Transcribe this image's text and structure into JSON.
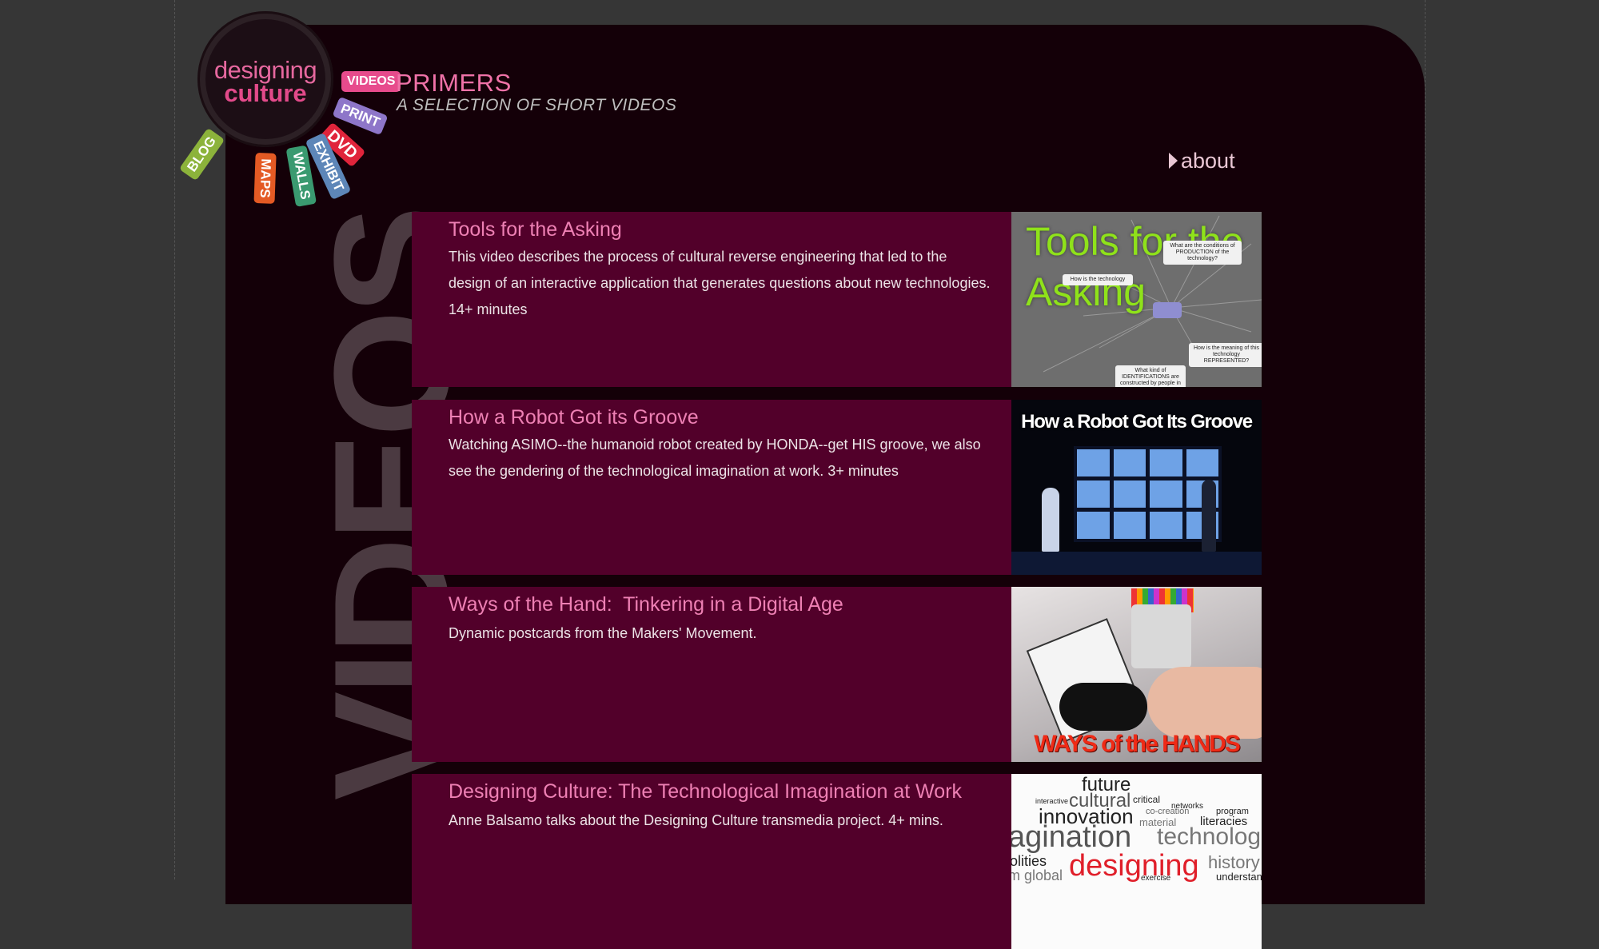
{
  "logo": {
    "line1": "designing",
    "line2": "culture"
  },
  "nav_tags": {
    "videos": "VIDEOS",
    "print": "PRINT",
    "dvd": "DVD",
    "exhibit": "EXHIBIT",
    "walls": "WALLS",
    "maps": "MAPS",
    "blog": "BLOG"
  },
  "header": {
    "title": "PRIMERS",
    "subtitle": "A SELECTION OF SHORT VIDEOS",
    "about_label": "about"
  },
  "section_word": "VIDEOS",
  "videos": [
    {
      "title": "Tools for the Asking",
      "description": "This video describes the process of cultural reverse engineering that led to the design of an interactive application that generates questions about new technologies. 14+ minutes",
      "thumb_text": "Tools for the Asking",
      "thumb_notes": [
        "What are the conditions of PRODUCTION of the technology?",
        "How is the technology",
        "How is the meaning of this technology REPRESENTED?",
        "What kind of IDENTIFICATIONS are constructed by people in"
      ]
    },
    {
      "title": "How a Robot Got its Groove",
      "description": "Watching ASIMO--the humanoid robot created by HONDA--get HIS groove, we also see the gendering of the technological imagination at work. 3+ minutes",
      "thumb_text": "How a Robot Got Its Groove"
    },
    {
      "title": "Ways of the Hand:  Tinkering in a Digital Age",
      "description": "Dynamic postcards from the Makers' Movement.",
      "thumb_text": "WAYS of the HANDS"
    },
    {
      "title": "Designing Culture: The Technological Imagination at Work",
      "description": "Anne Balsamo talks about the Designing Culture transmedia project. 4+ mins.",
      "thumb_words": [
        "future",
        "cultural",
        "critical",
        "interactive",
        "networks",
        "innovation",
        "co-creation",
        "program",
        "material",
        "literacies",
        "agination",
        "technologies",
        "olities",
        "designing",
        "history",
        "m global",
        "exercise",
        "understan"
      ]
    }
  ],
  "colors": {
    "background": "#363636",
    "panel": "#140008",
    "row": "#52002a",
    "accent_pink": "#ef72a8",
    "title_pink": "#ee80b4"
  }
}
